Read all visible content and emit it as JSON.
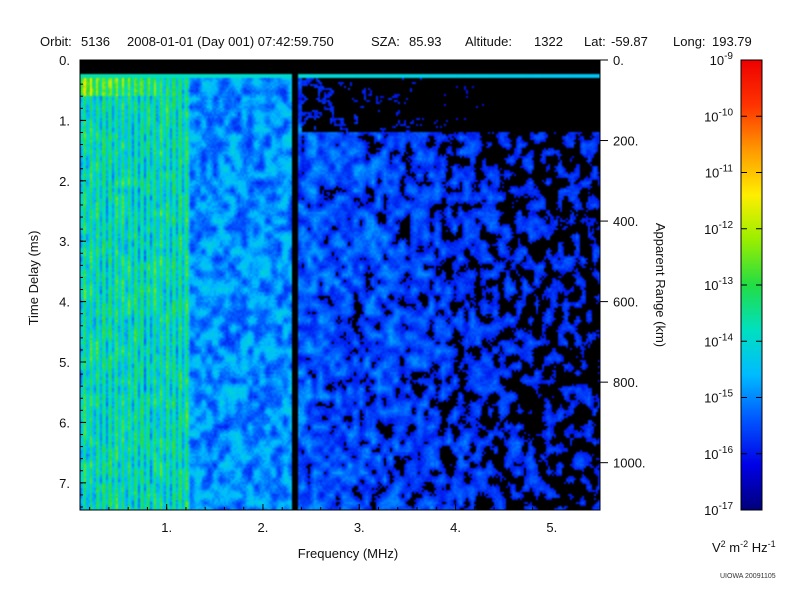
{
  "header": {
    "orbit_label": "Orbit:",
    "orbit": "5136",
    "datetime": "2008-01-01 (Day 001) 07:42:59.750",
    "sza_label": "SZA:",
    "sza": "85.93",
    "altitude_label": "Altitude:",
    "altitude": "1322",
    "lat_label": "Lat:",
    "lat": "-59.87",
    "long_label": "Long:",
    "long": "193.79"
  },
  "credit": "UIOWA 20091105",
  "chart_data": {
    "type": "heatmap",
    "title": "",
    "xlabel": "Frequency (MHz)",
    "ylabel": "Time Delay (ms)",
    "y2label": "Apparent Range (km)",
    "xlim": [
      0.1,
      5.5
    ],
    "ylim": [
      0,
      7.45
    ],
    "x_ticks": [
      1,
      2,
      3,
      4,
      5
    ],
    "x_tick_labels": [
      "1.",
      "2.",
      "3.",
      "4.",
      "5."
    ],
    "y_ticks": [
      0,
      1,
      2,
      3,
      4,
      5,
      6,
      7
    ],
    "y_tick_labels": [
      "0.",
      "1.",
      "2.",
      "3.",
      "4.",
      "5.",
      "6.",
      "7."
    ],
    "y2_ticks_km": [
      0,
      200,
      400,
      600,
      800,
      1000
    ],
    "y2_tick_labels": [
      "0.",
      "200.",
      "400.",
      "600.",
      "800.",
      "1000."
    ],
    "km_per_ms": 150,
    "colorbar": {
      "scale": "log",
      "range": [
        1e-17,
        1e-09
      ],
      "unit_text": [
        "V",
        "2",
        " m",
        "-2",
        " Hz",
        "-1"
      ],
      "tick_exponents": [
        -9,
        -10,
        -11,
        -12,
        -13,
        -14,
        -15,
        -16,
        -17
      ],
      "colors": [
        "#00007a",
        "#0000e6",
        "#0055ff",
        "#00bbff",
        "#00e0c0",
        "#22dd44",
        "#99ee00",
        "#ffee00",
        "#ff9900",
        "#ff3300",
        "#ee0000"
      ]
    },
    "features": {
      "blank_band_ms": [
        0,
        0.22
      ],
      "transmit_pulse_ms": 0.25,
      "dark_vertical_line_mhz": 2.33,
      "bright_region_max_mhz": 1.25,
      "dark_upper_right_from_mhz": 2.4
    }
  }
}
